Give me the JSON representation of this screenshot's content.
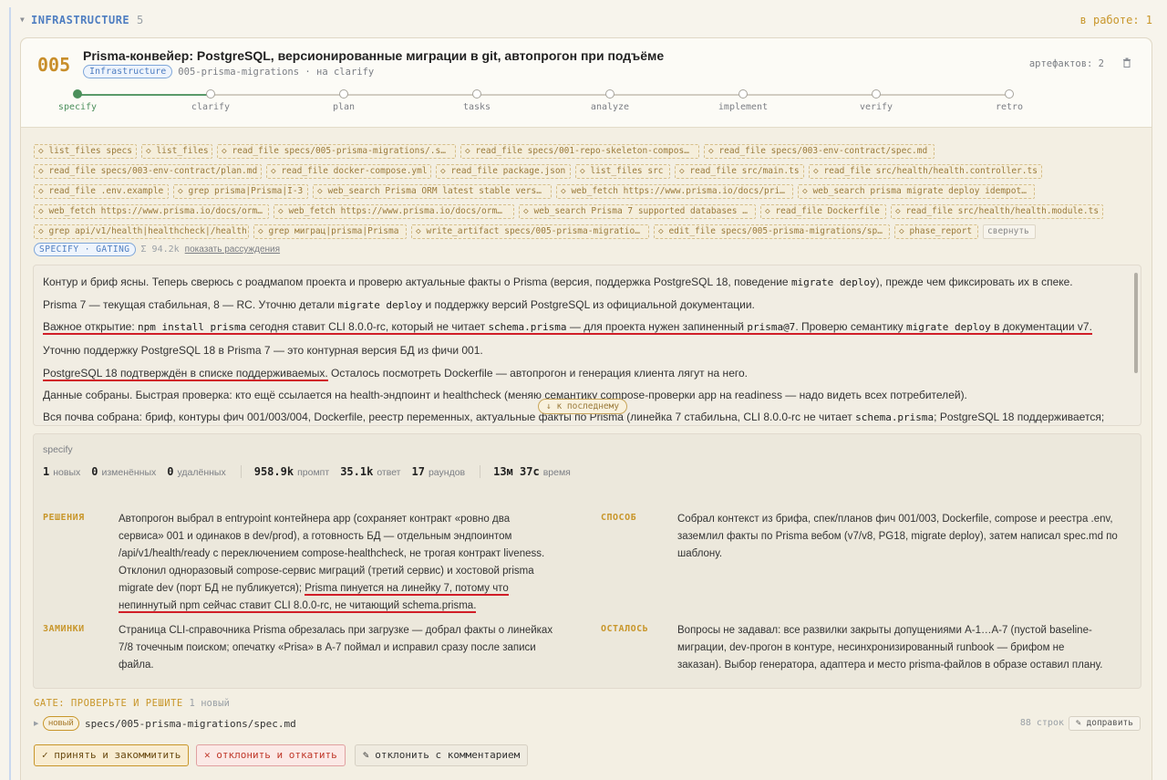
{
  "section": {
    "name": "INFRASTRUCTURE",
    "count": "5",
    "in_work": "в работе: 1"
  },
  "task": {
    "number": "005",
    "title": "Prisma-конвейер: PostgreSQL, версионированные миграции в git, автопрогон при подъёме",
    "tag": "Infrastructure",
    "slug": "005-prisma-migrations · на clarify",
    "artifacts": "артефактов: 2"
  },
  "stages": [
    {
      "label": "specify",
      "done": true
    },
    {
      "label": "clarify"
    },
    {
      "label": "plan"
    },
    {
      "label": "tasks"
    },
    {
      "label": "analyze"
    },
    {
      "label": "implement"
    },
    {
      "label": "verify"
    },
    {
      "label": "retro"
    }
  ],
  "tool_calls": [
    "◇ list_files specs",
    "◇ list_files",
    "◇ read_file specs/005-prisma-migrations/.s…",
    "◇ read_file specs/001-repo-skeleton-compos…",
    "◇ read_file specs/003-env-contract/spec.md",
    "◇ read_file specs/003-env-contract/plan.md",
    "◇ read_file docker-compose.yml",
    "◇ read_file package.json",
    "◇ list_files src",
    "◇ read_file src/main.ts",
    "◇ read_file src/health/health.controller.ts",
    "◇ read_file .env.example",
    "◇ grep prisma|Prisma|I-3",
    "◇ web_search Prisma ORM latest stable vers…",
    "◇ web_fetch https://www.prisma.io/docs/pri…",
    "◇ web_search prisma migrate deploy idempot…",
    "◇ web_fetch https://www.prisma.io/docs/orm…",
    "◇ web_fetch https://www.prisma.io/docs/orm…",
    "◇ web_search Prisma 7 supported databases …",
    "◇ read_file Dockerfile",
    "◇ read_file src/health/health.module.ts",
    "◇ grep api/v1/health|healthcheck|/health",
    "◇ grep миграц|prisma|Prisma",
    "◇ write_artifact specs/005-prisma-migratio…",
    "◇ edit_file specs/005-prisma-migrations/sp…",
    "◇ phase_report"
  ],
  "collapse_label": "свернуть",
  "gating": {
    "badge": "SPECIFY · GATING",
    "sigma": "Σ 94.2k",
    "show_reasoning": "показать рассуждения"
  },
  "reasoning": {
    "l1": {
      "a": "Контур и бриф ясны. Теперь сверюсь с роадмапом проекта и проверю актуальные факты о Prisma (версия, поддержка PostgreSQL 18, поведение ",
      "code": "migrate deploy",
      "b": "), прежде чем фиксировать их в спеке."
    },
    "l2": {
      "a": "Prisma 7 — текущая стабильная, 8 — RC. Уточню детали ",
      "code": "migrate deploy",
      "b": " и поддержку версий PostgreSQL из официальной документации."
    },
    "l3": {
      "a": "Важное открытие: ",
      "c1": "npm install prisma",
      "b": " сегодня ставит CLI 8.0.0-rc, который не читает ",
      "c2": "schema.prisma",
      "c": " — для проекта нужен запиненный ",
      "c3": "prisma@7",
      "d": ". Проверю семантику ",
      "c4": "migrate deploy",
      "e": " в документации v7."
    },
    "l4": "Уточню поддержку PostgreSQL 18 в Prisma 7 — это контурная версия БД из фичи 001.",
    "l5": {
      "a": "PostgreSQL 18 подтверждён в списке поддерживаемых.",
      "b": " Осталось посмотреть Dockerfile — автопрогон и генерация клиента лягут на него."
    },
    "l6": "Данные собраны. Быстрая проверка: кто ещё ссылается на health-эндпоинт и healthcheck (меняю семантику compose-проверки app на readiness — надо видеть всех потребителей).",
    "l7": {
      "a": "Вся почва собрана: бриф, контуры фич 001/003/004, Dockerfile, реестр переменных, актуальные факты по Prisma (линейка 7 стабильна, CLI 8.0.0-rc не читает ",
      "code": "schema.prisma",
      "b": "; PostgreSQL 18 поддерживается;"
    },
    "to_last": "↓ к последнему"
  },
  "summary": {
    "title": "specify",
    "new_count": "1",
    "new_label": "новых",
    "changed_count": "0",
    "changed_label": "изменённых",
    "deleted_count": "0",
    "deleted_label": "удалённых",
    "prompt_count": "958.9k",
    "prompt_label": "промпт",
    "answer_count": "35.1k",
    "answer_label": "ответ",
    "rounds_count": "17",
    "rounds_label": "раундов",
    "time_count": "13м 37с",
    "time_label": "время",
    "decisions_label": "РЕШЕНИЯ",
    "decisions_l1": "Автопрогон выбрал в entrypoint контейнера app (сохраняет контракт «ровно два",
    "decisions_l2": "сервиса» 001 и одинаков в dev/prod), а готовность БД — отдельным эндпоинтом",
    "decisions_l3": "/api/v1/health/ready с переключением compose-healthcheck, не трогая контракт liveness.",
    "decisions_l4": "Отклонил одноразовый compose-сервис миграций (третий сервис) и хостовой prisma",
    "decisions_l5a": "migrate dev (порт БД не публикуется); ",
    "decisions_l5b": "Prisma пинуется на линейку 7, потому что",
    "decisions_l6": "непиннутый npm сейчас ставит CLI 8.0.0-rc, не читающий schema.prisma.",
    "method_label": "СПОСОБ",
    "method_l1": "Собрал контекст из брифа, спек/планов фич 001/003, Dockerfile, compose и реестра .env,",
    "method_l2": "заземлил факты по Prisma вебом (v7/v8, PG18, migrate deploy), затем написал spec.md по",
    "method_l3": "шаблону.",
    "snags_label": "ЗАМИНКИ",
    "snags_l1": "Страница CLI-справочника Prisma обрезалась при загрузке — добрал факты о линейках",
    "snags_l2": "7/8 точечным поиском; опечатку «Prisa» в A-7 поймал и исправил сразу после записи",
    "snags_l3": "файла.",
    "left_label": "ОСТАЛОСЬ",
    "left_l1": "Вопросы не задавал: все развилки закрыты допущениями A-1…A-7 (пустой baseline-",
    "left_l2": "миграции, dev-прогон в контуре, несинхронизированный runbook — брифом не",
    "left_l3": "заказан). Выбор генератора, адаптера и место prisma-файлов в образе оставил плану."
  },
  "gate": {
    "label": "GATE: ПРОВЕРЬТЕ И РЕШИТЕ",
    "count": "1 новый",
    "badge_new": "новый",
    "file": "specs/005-prisma-migrations/spec.md",
    "rows": "88 строк",
    "refine": "✎ доправить"
  },
  "actions": {
    "accept": "✓ принять и закоммитить",
    "reject": "✕ отклонить и откатить",
    "comment": "✎ отклонить с комментарием"
  },
  "colors": {
    "accent_orange": "#c8962a",
    "accent_blue": "#4f7ec1",
    "done_green": "#4b8f5b",
    "highlight_red": "#d11e28"
  }
}
